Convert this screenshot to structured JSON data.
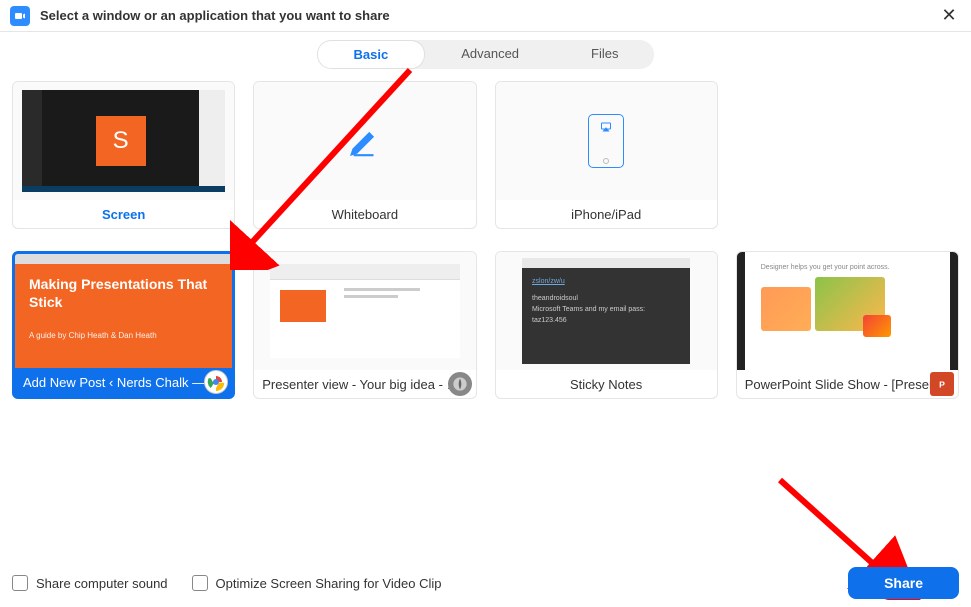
{
  "titlebar": {
    "title": "Select a window or an application that you want to share"
  },
  "tabs": {
    "basic": "Basic",
    "advanced": "Advanced",
    "files": "Files",
    "active": "basic"
  },
  "tiles": {
    "screen": {
      "label": "Screen",
      "orange_letter": "S"
    },
    "whiteboard": {
      "label": "Whiteboard"
    },
    "iphone": {
      "label": "iPhone/iPad"
    },
    "chrome_window": {
      "label": "Add New Post ‹ Nerds Chalk — …",
      "slide_title": "Making Presentations That Stick",
      "slide_sub": "A guide by Chip Heath & Dan Heath"
    },
    "presenter": {
      "label": "Presenter view - Your big idea - G…"
    },
    "sticky": {
      "label": "Sticky Notes",
      "line1": "zslon/zw/u",
      "line2": "theandroidsoul",
      "line3": "Microsoft Teams and my email pass:",
      "line4": "taz123.456"
    },
    "powerpoint": {
      "label": "PowerPoint Slide Show - [Present…",
      "header_text": "Designer helps you get your point across."
    }
  },
  "footer": {
    "share_sound": "Share computer sound",
    "optimize": "Optimize Screen Sharing for Video Clip",
    "share_button": "Share"
  },
  "colors": {
    "accent": "#0E71EB",
    "orange": "#F26522",
    "arrow": "#FF0000"
  }
}
